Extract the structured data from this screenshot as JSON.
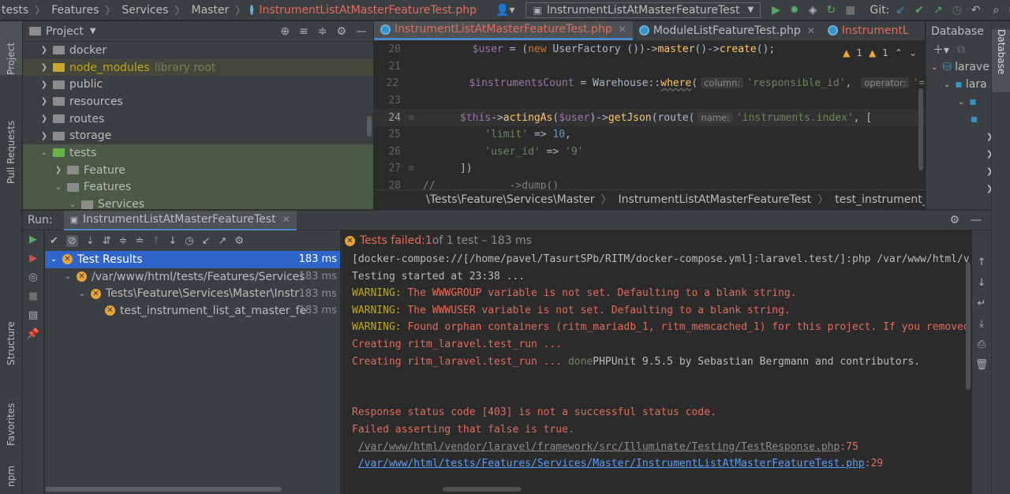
{
  "navbar": {
    "breadcrumbs": [
      "tests",
      "Features",
      "Services",
      "Master"
    ],
    "file": "InstrumentListAtMasterFeatureTest.php",
    "run_config": "InstrumentListAtMasterFeatureTest",
    "git_label": "Git:"
  },
  "left_strip": {
    "project": "Project",
    "pull_requests": "Pull Requests",
    "structure": "Structure",
    "favorites": "Favorites",
    "npm": "npm"
  },
  "right_strip": {
    "database": "Database"
  },
  "project": {
    "title": "Project",
    "items": [
      {
        "label": "docker",
        "extra": ""
      },
      {
        "label": "node_modules",
        "extra": "library root"
      },
      {
        "label": "public",
        "extra": ""
      },
      {
        "label": "resources",
        "extra": ""
      },
      {
        "label": "routes",
        "extra": ""
      },
      {
        "label": "storage",
        "extra": ""
      },
      {
        "label": "tests",
        "extra": ""
      },
      {
        "label": "Feature",
        "extra": ""
      },
      {
        "label": "Features",
        "extra": ""
      },
      {
        "label": "Services",
        "extra": ""
      }
    ]
  },
  "editor": {
    "tabs": [
      {
        "label": "InstrumentListAtMasterFeatureTest.php"
      },
      {
        "label": "ModuleListFeatureTest.php"
      },
      {
        "label": "InstrumentL"
      }
    ],
    "line_numbers": [
      "20",
      "21",
      "22",
      "23",
      "24",
      "25",
      "26",
      "27",
      "28"
    ],
    "inspections": {
      "warnings": "1",
      "weak": "1"
    },
    "code": {
      "l20_var": "$user",
      "l20_a": " = (",
      "l20_new": "new",
      "l20_b": " UserFactory ())->",
      "l20_master": "master",
      "l20_c": "()->",
      "l20_create": "create",
      "l20_d": "();",
      "l22_var": "$instrumentsCount",
      "l22_a": " = Warehouse::",
      "l22_where": "where",
      "l22_b": "(",
      "l22_hint1": "column:",
      "l22_str": "'responsible_id'",
      "l22_c": ",",
      "l22_hint2": "operator:",
      "l22_d": "'=",
      "l24_this": "$this",
      "l24_a": "->",
      "l24_acting": "actingAs",
      "l24_b": "(",
      "l24_user": "$user",
      "l24_c": ")->",
      "l24_getjson": "getJson",
      "l24_d": "(route(",
      "l24_hint": "name:",
      "l24_str": "'instruments.index'",
      "l24_e": ", [",
      "l25_str": "'limit'",
      "l25_a": " => ",
      "l25_num": "10",
      "l25_b": ",",
      "l26_str": "'user_id'",
      "l26_a": " => ",
      "l26_str2": "'9'",
      "l27": "])",
      "l28_a": "//",
      "l28_b": "->dump()"
    },
    "breadcrumb": [
      "\\Tests\\Feature\\Services\\Master",
      "InstrumentListAtMasterFeatureTest",
      "test_instrument_lis"
    ]
  },
  "database": {
    "title": "Database",
    "rows": [
      "larave",
      "lara"
    ]
  },
  "run": {
    "label": "Run:",
    "tab": "InstrumentListAtMasterFeatureTest",
    "status_failed": "Tests failed: ",
    "status_count": "1",
    "status_rest": " of 1 test – 183 ms",
    "tree": [
      {
        "label": "Test Results",
        "ms": "183 ms"
      },
      {
        "label": "/var/www/html/tests/Features/Services",
        "ms": "183 ms"
      },
      {
        "label": "Tests\\Feature\\Services\\Master\\Instr",
        "ms": "183 ms"
      },
      {
        "label": "test_instrument_list_at_master_fe",
        "ms": "183 ms"
      }
    ],
    "console": {
      "l1": "[docker-compose://[/home/pavel/TasurtSPb/RITM/docker-compose.yml]:laravel.test/]:php /var/www/html/v",
      "l2": "Testing started at 23:38 ...",
      "l3_tag": "WARNING:",
      "l3_msg": " The WWWGROUP variable is not set. Defaulting to a blank string.",
      "l4_tag": "WARNING:",
      "l4_msg": " The WWWUSER variable is not set. Defaulting to a blank string.",
      "l5_tag": "WARNING:",
      "l5_msg": " Found orphan containers (ritm_mariadb_1, ritm_memcached_1) for this project. If you removed",
      "l6": "Creating ritm_laravel.test_run ...",
      "l7_a": "Creating ritm_laravel.test_run ... ",
      "l7_done": "done",
      "l7_b": "PHPUnit 9.5.5 by Sebastian Bergmann and contributors.",
      "l8": "Response status code [403] is not a successful status code.",
      "l9": "Failed asserting that false is true.",
      "l10_link": "/var/www/html/vendor/laravel/framework/src/Illuminate/Testing/TestResponse.php",
      "l10_ln": ":75",
      "l11_link": "/var/www/html/tests/Features/Services/Master/InstrumentListAtMasterFeatureTest.php",
      "l11_ln": ":29"
    }
  }
}
